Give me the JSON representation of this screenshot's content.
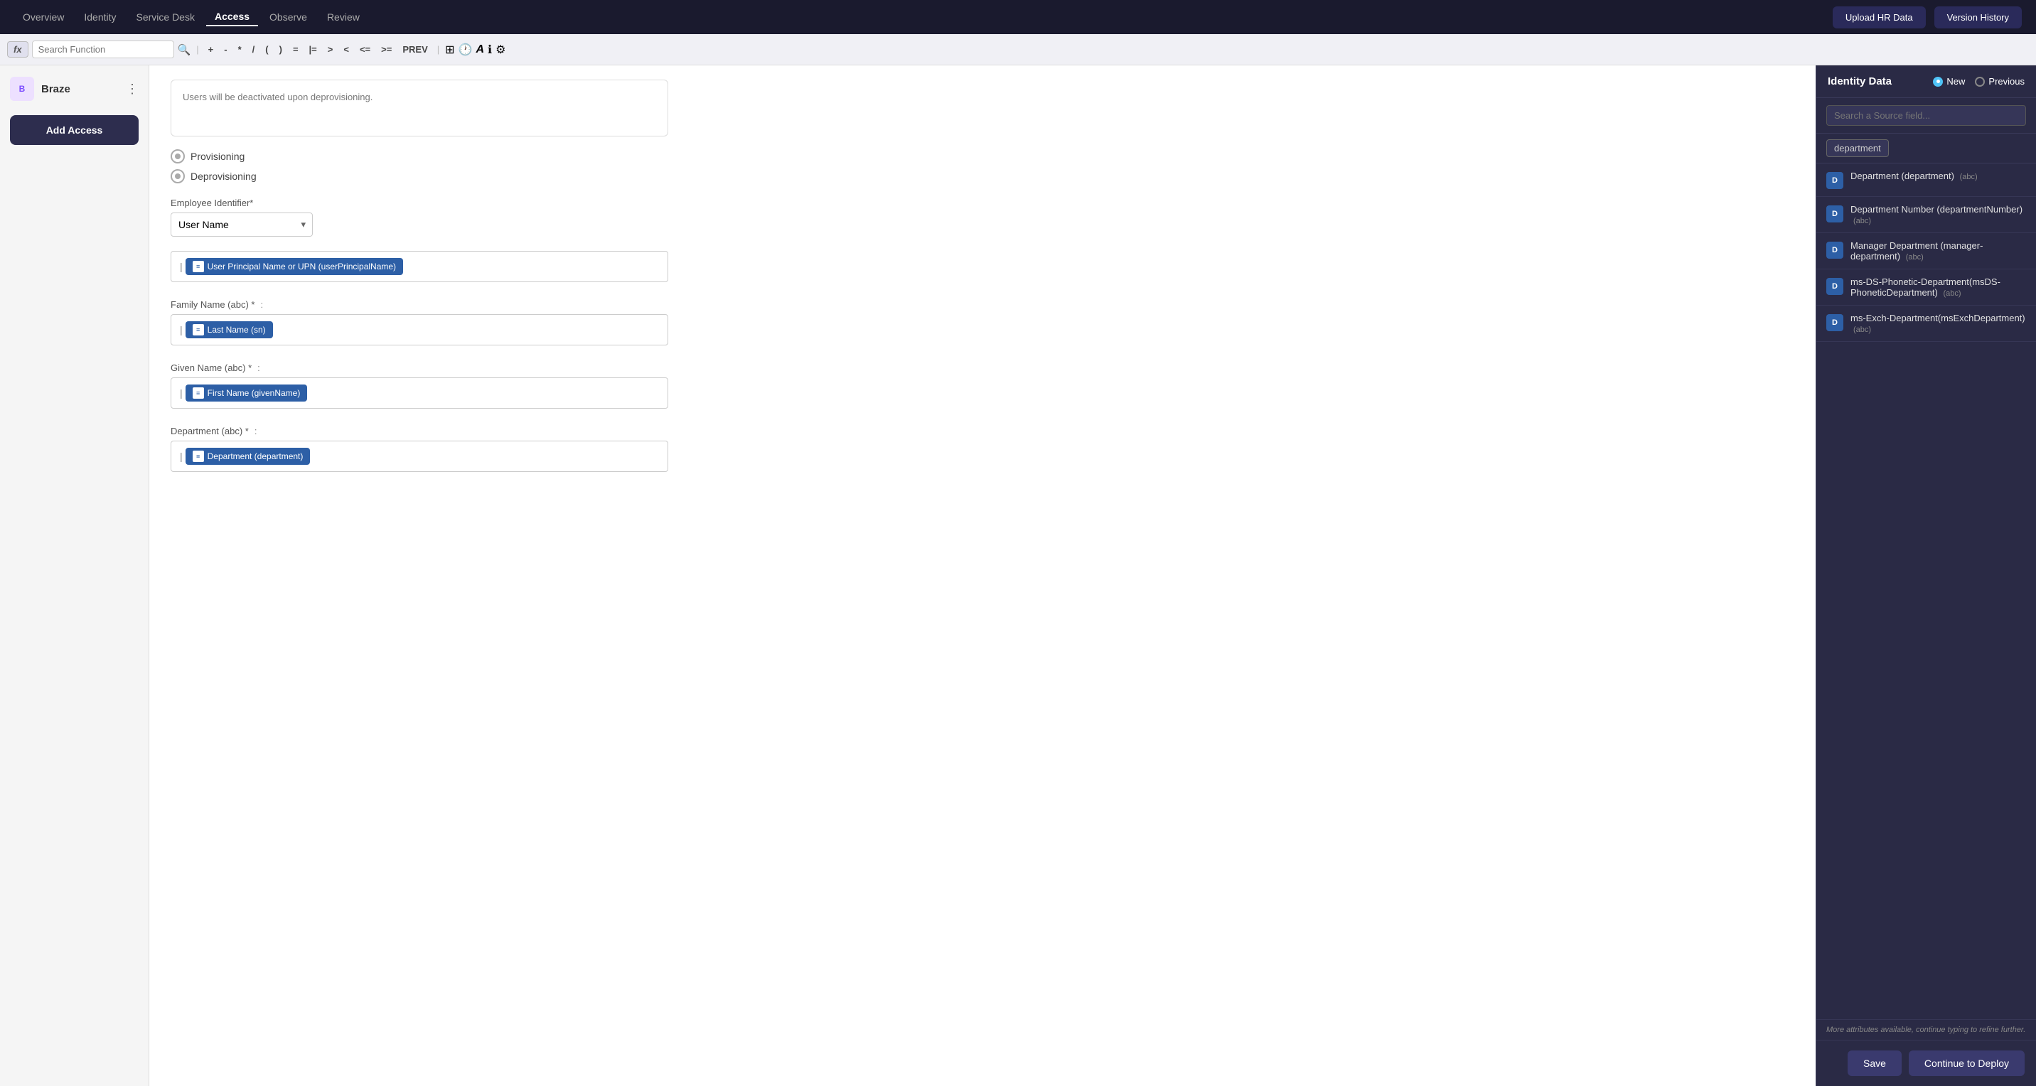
{
  "nav": {
    "items": [
      {
        "label": "Overview",
        "active": false
      },
      {
        "label": "Identity",
        "active": false
      },
      {
        "label": "Service Desk",
        "active": false
      },
      {
        "label": "Access",
        "active": true
      },
      {
        "label": "Observe",
        "active": false
      },
      {
        "label": "Review",
        "active": false
      }
    ],
    "upload_btn": "Upload HR Data",
    "version_btn": "Version History"
  },
  "formula_bar": {
    "fx_label": "fx",
    "search_placeholder": "Search Function",
    "operators": [
      "+",
      "-",
      "*",
      "/",
      "(",
      ")",
      "=",
      "|=",
      ">",
      "<",
      "<=",
      ">=",
      "PREV"
    ]
  },
  "sidebar": {
    "brand_name": "Braze",
    "logo_text": "B",
    "add_access_label": "Add Access"
  },
  "main": {
    "deprovisioning_note": "Users will be deactivated upon deprovisioning.",
    "provisioning_label": "Provisioning",
    "deprovisioning_label": "Deprovisioning",
    "employee_id_label": "Employee Identifier*",
    "employee_id_value": "User Name",
    "upn_tag": "User Principal Name or UPN (userPrincipalName)",
    "family_name_label": "Family Name (abc) *",
    "family_name_colon": ":",
    "family_name_tag": "Last Name (sn)",
    "given_name_label": "Given Name (abc) *",
    "given_name_colon": ":",
    "given_name_tag": "First Name (givenName)",
    "department_label": "Department (abc) *",
    "department_colon": ":",
    "department_tag": "Department (department)"
  },
  "right_panel": {
    "title": "Identity Data",
    "radio_new": "New",
    "radio_previous": "Previous",
    "search_placeholder": "Search a Source field...",
    "filter_value": "department",
    "items": [
      {
        "name": "Department (department)",
        "type": "(abc)",
        "icon": "D"
      },
      {
        "name": "Department Number (departmentNumber)",
        "type": "(abc)",
        "icon": "D"
      },
      {
        "name": "Manager Department (manager-department)",
        "type": "(abc)",
        "icon": "D"
      },
      {
        "name": "ms-DS-Phonetic-Department(msDS-PhoneticDepartment)",
        "type": "(abc)",
        "icon": "D"
      },
      {
        "name": "ms-Exch-Department(msExchDepartment)",
        "type": "(abc)",
        "icon": "D"
      }
    ],
    "footer_note": "More attributes available, continue typing to refine further.",
    "save_label": "Save",
    "deploy_label": "Continue to Deploy"
  }
}
